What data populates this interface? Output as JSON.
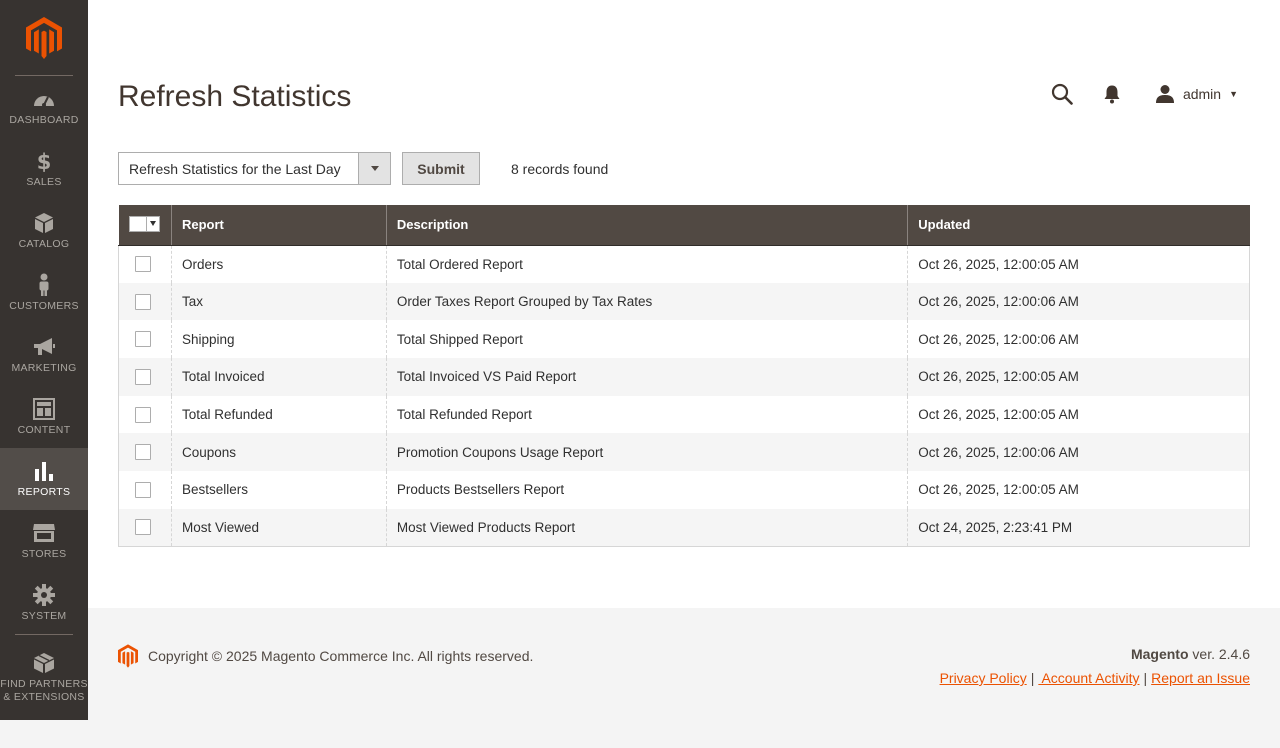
{
  "sidebar": {
    "items": [
      {
        "label": "DASHBOARD",
        "icon": "dashboard-icon"
      },
      {
        "label": "SALES",
        "icon": "dollar-icon"
      },
      {
        "label": "CATALOG",
        "icon": "cube-icon"
      },
      {
        "label": "CUSTOMERS",
        "icon": "person-icon"
      },
      {
        "label": "MARKETING",
        "icon": "megaphone-icon"
      },
      {
        "label": "CONTENT",
        "icon": "layout-icon"
      },
      {
        "label": "REPORTS",
        "icon": "bar-chart-icon",
        "active": true
      },
      {
        "label": "STORES",
        "icon": "storefront-icon"
      },
      {
        "label": "SYSTEM",
        "icon": "gear-icon"
      }
    ],
    "partners": {
      "line1": "FIND PARTNERS",
      "line2": "& EXTENSIONS",
      "icon": "boxes-icon"
    }
  },
  "header": {
    "title": "Refresh Statistics",
    "user": "admin"
  },
  "toolbar": {
    "action_select": "Refresh Statistics for the Last Day",
    "submit_label": "Submit",
    "records": "8 records found"
  },
  "grid": {
    "columns": [
      "Report",
      "Description",
      "Updated"
    ],
    "rows": [
      {
        "report": "Orders",
        "description": "Total Ordered Report",
        "updated": "Oct 26, 2025, 12:00:05 AM"
      },
      {
        "report": "Tax",
        "description": "Order Taxes Report Grouped by Tax Rates",
        "updated": "Oct 26, 2025, 12:00:06 AM"
      },
      {
        "report": "Shipping",
        "description": "Total Shipped Report",
        "updated": "Oct 26, 2025, 12:00:06 AM"
      },
      {
        "report": "Total Invoiced",
        "description": "Total Invoiced VS Paid Report",
        "updated": "Oct 26, 2025, 12:00:05 AM"
      },
      {
        "report": "Total Refunded",
        "description": "Total Refunded Report",
        "updated": "Oct 26, 2025, 12:00:05 AM"
      },
      {
        "report": "Coupons",
        "description": "Promotion Coupons Usage Report",
        "updated": "Oct 26, 2025, 12:00:06 AM"
      },
      {
        "report": "Bestsellers",
        "description": "Products Bestsellers Report",
        "updated": "Oct 26, 2025, 12:00:05 AM"
      },
      {
        "report": "Most Viewed",
        "description": "Most Viewed Products Report",
        "updated": "Oct 24, 2025, 2:23:41 PM"
      }
    ]
  },
  "footer": {
    "copyright": "Copyright © 2025 Magento Commerce Inc. All rights reserved.",
    "brand": "Magento",
    "version": " ver. 2.4.6",
    "links": [
      "Privacy Policy",
      " Account Activity",
      "Report an Issue"
    ]
  },
  "colors": {
    "sidebar_bg": "#373330",
    "sidebar_active": "#524d49",
    "grid_header": "#514943",
    "brand_orange": "#eb5202"
  }
}
